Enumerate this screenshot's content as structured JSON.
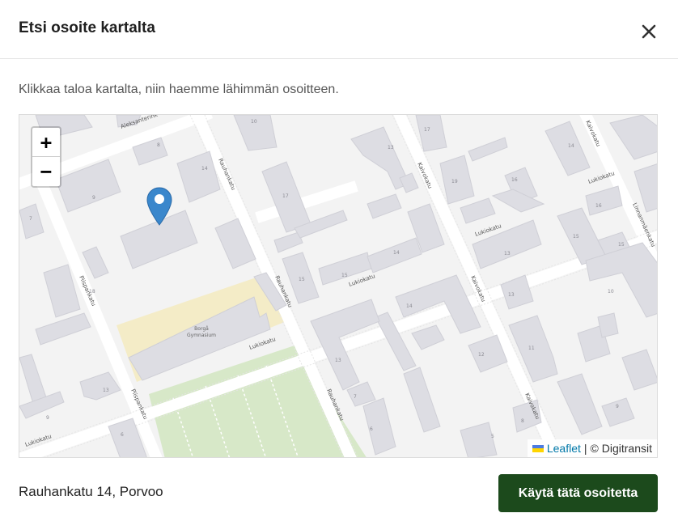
{
  "dialog": {
    "title": "Etsi osoite kartalta",
    "close_icon": "close-icon"
  },
  "instruction": "Klikkaa taloa kartalta, niin haemme lähimmän osoitteen.",
  "map": {
    "zoom_in_label": "+",
    "zoom_out_label": "−",
    "streets": {
      "rauhankatu": "Rauhankatu",
      "lukiokatu": "Lukiokatu",
      "kaivokatu": "Kaivokatu",
      "piispankatu": "Piispankatu",
      "aleksanterinkatu": "Aleksanterink",
      "linnanmaenkatu": "Linnanmäenkatu"
    },
    "school_label_1": "Borgå",
    "school_label_2": "Gymnasium",
    "house_numbers": {
      "n10": "10",
      "n17": "17",
      "n13": "13",
      "n19": "19",
      "n16": "16",
      "n14": "14",
      "n15": "15",
      "n12": "12",
      "n11": "11",
      "n9": "9",
      "n8": "8",
      "n7": "7",
      "n6": "6",
      "n5": "5",
      "n18": "18"
    },
    "marker_icon": "map-marker-icon",
    "attribution": {
      "flag_icon": "ukraine-flag-icon",
      "leaflet_link": "Leaflet",
      "separator": "|",
      "provider": "© Digitransit"
    },
    "colors": {
      "background": "#f3f3f3",
      "building": "#dddde3",
      "road": "#ffffff",
      "park": "#d7e8c8",
      "schoolyard": "#f4ecc7",
      "marker": "#3a87cc"
    }
  },
  "footer": {
    "selected_address": "Rauhankatu 14, Porvoo",
    "use_button_label": "Käytä tätä osoitetta"
  }
}
